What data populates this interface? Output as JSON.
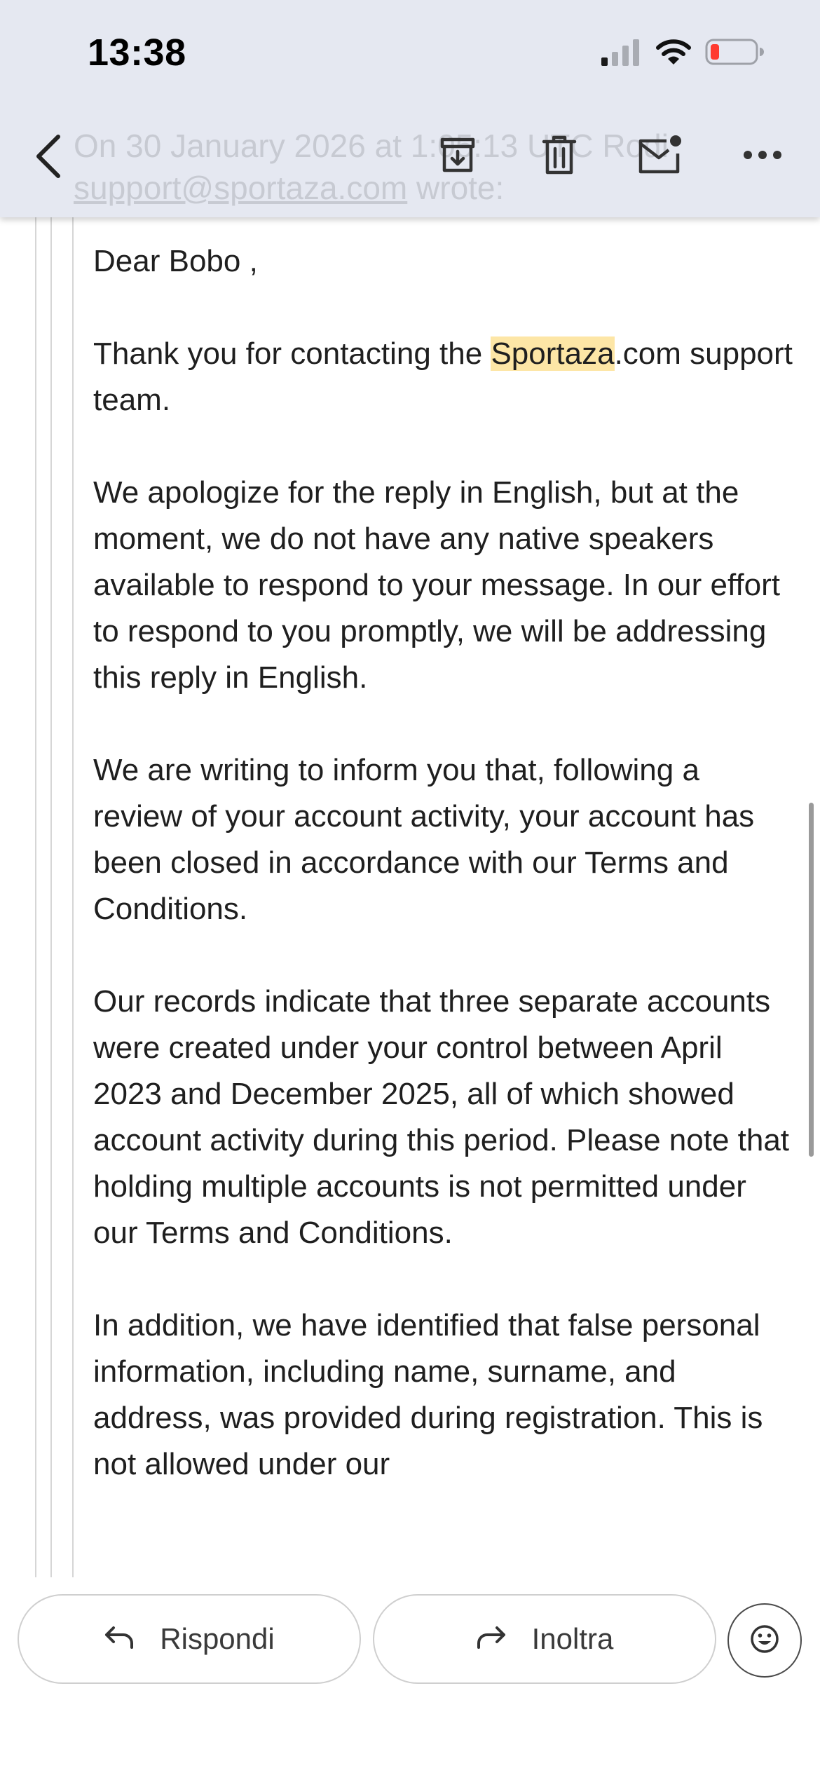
{
  "status_bar": {
    "time": "13:38",
    "icons": [
      "cellular-signal-icon",
      "wifi-icon",
      "battery-low-icon"
    ]
  },
  "header": {
    "quoted_header_line1": "On 30 January 2026 at 1:05:13 UTC Rodi",
    "quoted_header_email": "support@sportaza.com",
    "quoted_header_wrote": "wrote:",
    "icons": [
      "back-chevron-icon",
      "archive-icon",
      "trash-icon",
      "mark-unread-icon",
      "more-horizontal-icon"
    ]
  },
  "message": {
    "greeting": "Dear Bobo ,",
    "p1_before": "Thank you for contacting the ",
    "p1_highlight": "Sportaza",
    "p1_after": ".com support team.",
    "p2": "We apologize for the reply in English, but at the moment, we do not have any native speakers available to respond to your message. In our effort to respond to you promptly, we will be addressing this reply in English.",
    "p3": "We are writing to inform you that, following a review of your account activity, your account has been closed in accordance with our Terms and Conditions.",
    "p4": "Our records indicate that three separate accounts were created under your control between April 2023 and December 2025, all of which showed account activity during this period. Please note that holding multiple accounts is not permitted under our Terms and Conditions.",
    "p5": "In addition, we have identified that false personal information, including name, surname, and address, was provided during registration. This is not allowed under our"
  },
  "actions": {
    "reply_label": "Rispondi",
    "forward_label": "Inoltra",
    "icons": [
      "reply-arrow-icon",
      "forward-arrow-icon",
      "emoji-reaction-icon"
    ]
  },
  "colors": {
    "header_bg": "#e5e8f1",
    "highlight": "#fde6a6",
    "battery_low": "#ff3b30"
  }
}
